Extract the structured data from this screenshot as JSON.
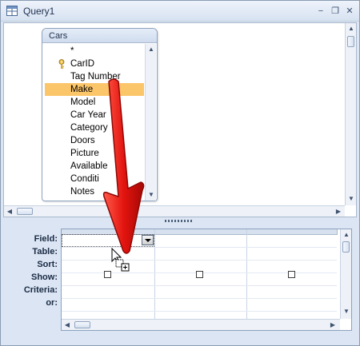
{
  "window": {
    "title": "Query1",
    "icon": "query-icon",
    "controls": {
      "minimize": "−",
      "restore": "❐",
      "close": "✕"
    }
  },
  "table": {
    "title": "Cars",
    "fields": [
      {
        "label": "*",
        "is_key": false,
        "selected": false
      },
      {
        "label": "CarID",
        "is_key": true,
        "selected": false
      },
      {
        "label": "Tag Number",
        "is_key": false,
        "selected": false
      },
      {
        "label": "Make",
        "is_key": false,
        "selected": true
      },
      {
        "label": "Model",
        "is_key": false,
        "selected": false
      },
      {
        "label": "Car Year",
        "is_key": false,
        "selected": false
      },
      {
        "label": "Category",
        "is_key": false,
        "selected": false
      },
      {
        "label": "Doors",
        "is_key": false,
        "selected": false
      },
      {
        "label": "Picture",
        "is_key": false,
        "selected": false
      },
      {
        "label": "Available",
        "is_key": false,
        "selected": false
      },
      {
        "label": "Conditi",
        "is_key": false,
        "selected": false
      },
      {
        "label": "Notes",
        "is_key": false,
        "selected": false
      }
    ]
  },
  "design_grid": {
    "row_labels": {
      "field": "Field:",
      "table": "Table:",
      "sort": "Sort:",
      "show": "Show:",
      "criteria": "Criteria:",
      "or": "or:"
    },
    "column_count": 3,
    "show_checked": [
      false,
      false,
      false
    ]
  },
  "annotation": {
    "arrow_color": "#e3140f",
    "description_icon": "drag-arrow"
  },
  "colors": {
    "selection": "#fbc56a",
    "chrome": "#dbe5f3",
    "border": "#8da2bf"
  }
}
